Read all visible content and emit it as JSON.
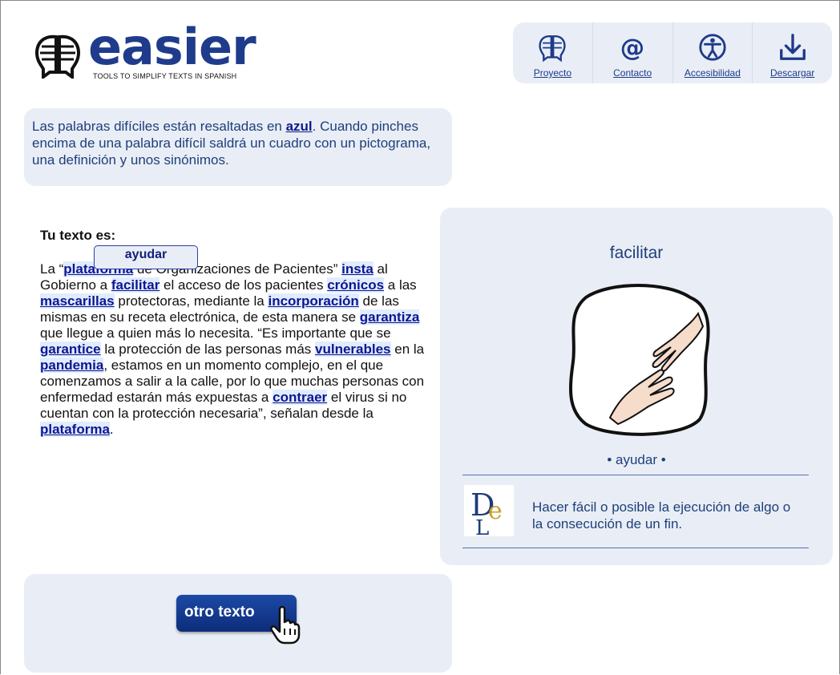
{
  "brand": {
    "name": "easier",
    "tagline": "TOOLS TO SIMPLIFY TEXTS IN SPANISH",
    "color": "#1f3c8c"
  },
  "nav": {
    "items": [
      {
        "label": "Proyecto",
        "icon": "brain-book-icon"
      },
      {
        "label": "Contacto",
        "icon": "at-sign-icon"
      },
      {
        "label": "Accesibilidad",
        "icon": "accessibility-icon"
      },
      {
        "label": "Descargar",
        "icon": "download-icon"
      }
    ]
  },
  "info": {
    "before": "Las palabras difíciles están resaltadas en ",
    "highlight": "azul",
    "after": ". Cuando pinches encima de una palabra difícil saldrá un cuadro con un pictograma, una definición y unos sinónimos."
  },
  "text": {
    "title": "Tu texto es:",
    "tooltip": "ayudar",
    "segments": [
      {
        "t": "La “"
      },
      {
        "w": "plataforma"
      },
      {
        "t": " de Organizaciones de Pacientes” "
      },
      {
        "w": "insta"
      },
      {
        "t": " al Gobierno a "
      },
      {
        "w": "facilitar"
      },
      {
        "t": " el acceso de los pacientes "
      },
      {
        "w": "crónicos"
      },
      {
        "t": " a las "
      },
      {
        "w": "mascarillas"
      },
      {
        "t": " protectoras, mediante la "
      },
      {
        "w": "incorporación"
      },
      {
        "t": " de las mismas en su receta electrónica, de esta manera se "
      },
      {
        "w": "garantiza"
      },
      {
        "t": " que llegue a quien más lo necesita. “Es importante que se "
      },
      {
        "w": "garantice"
      },
      {
        "t": " la protección de las personas más "
      },
      {
        "w": "vulnerables"
      },
      {
        "t": " en la "
      },
      {
        "w": "pandemia"
      },
      {
        "t": ", estamos en un momento complejo, en el que comenzamos a salir a la calle, por lo que muchas personas con enfermedad estarán más expuestas a "
      },
      {
        "w": "contraer"
      },
      {
        "t": " el virus si no cuentan con la protección necesaria”, señalan desde la "
      },
      {
        "w": "plataforma"
      },
      {
        "t": "."
      }
    ]
  },
  "panel": {
    "word": "facilitar",
    "synonyms": "• ayudar •",
    "definition": "Hacer fácil o posible la ejecución de algo o la consecución de un fin.",
    "pictogram": "helping-hands-pictogram",
    "source_logo": "rae-logo"
  },
  "actions": {
    "other_text": "otro texto"
  }
}
